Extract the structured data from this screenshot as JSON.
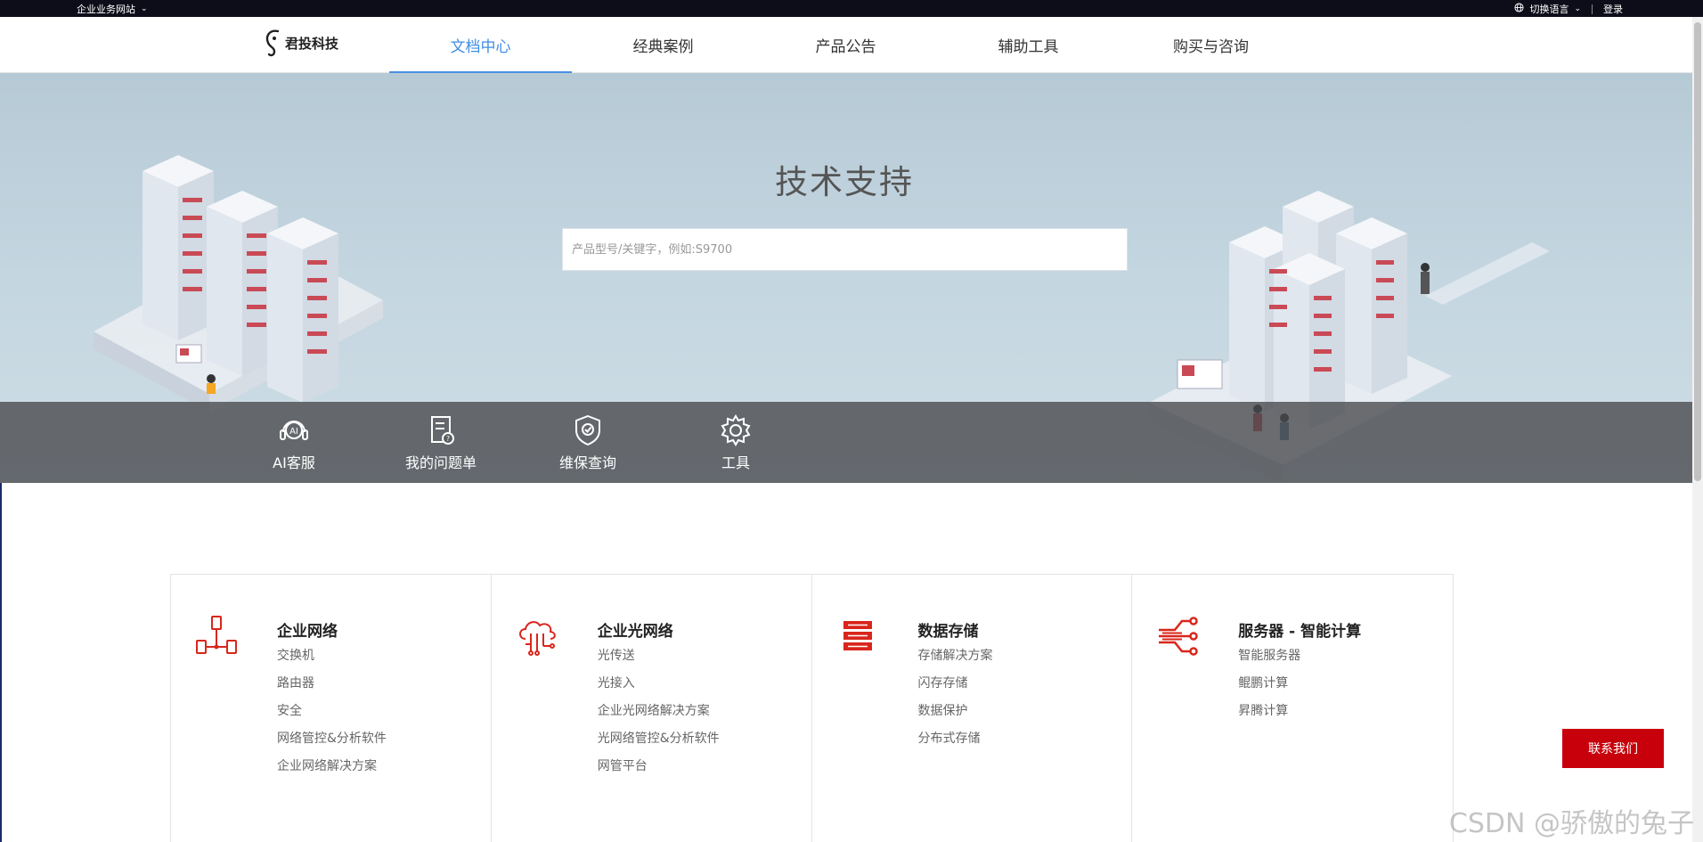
{
  "topbar": {
    "site_label": "企业业务网站",
    "language_label": "切换语言",
    "login_label": "登录"
  },
  "nav": {
    "logo_text": "君投科技",
    "items": [
      {
        "label": "文档中心",
        "active": true
      },
      {
        "label": "经典案例",
        "active": false
      },
      {
        "label": "产品公告",
        "active": false
      },
      {
        "label": "辅助工具",
        "active": false
      },
      {
        "label": "购买与咨询",
        "active": false
      }
    ]
  },
  "hero": {
    "title": "技术支持",
    "search_placeholder": "产品型号/关键字，例如:S9700"
  },
  "quick_links": [
    {
      "label": "AI客服",
      "icon": "ai-service-icon"
    },
    {
      "label": "我的问题单",
      "icon": "ticket-icon"
    },
    {
      "label": "维保查询",
      "icon": "shield-icon"
    },
    {
      "label": "工具",
      "icon": "gear-icon"
    }
  ],
  "categories": [
    {
      "title": "企业网络",
      "icon": "network-icon",
      "items": [
        "交换机",
        "路由器",
        "安全",
        "网络管控&分析软件",
        "企业网络解决方案"
      ]
    },
    {
      "title": "企业光网络",
      "icon": "cloud-circuit-icon",
      "items": [
        "光传送",
        "光接入",
        "企业光网络解决方案",
        "光网络管控&分析软件",
        "网管平台"
      ]
    },
    {
      "title": "数据存储",
      "icon": "storage-icon",
      "items": [
        "存储解决方案",
        "闪存存储",
        "数据保护",
        "分布式存储"
      ]
    },
    {
      "title": "服务器 - 智能计算",
      "icon": "compute-icon",
      "items": [
        "智能服务器",
        "鲲鹏计算",
        "昇腾计算"
      ]
    }
  ],
  "contact_label": "联系我们",
  "watermark": "CSDN @骄傲的兔子",
  "colors": {
    "accent": "#3f8ee5",
    "brand_red": "#c7000b",
    "icon_red": "#d9261c"
  }
}
